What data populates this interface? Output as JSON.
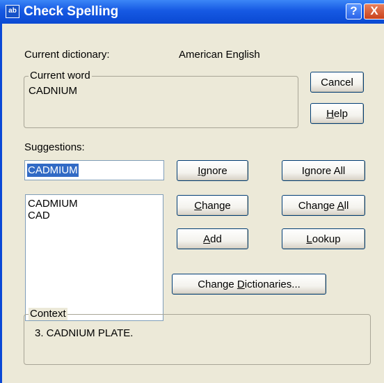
{
  "window": {
    "title": "Check Spelling",
    "icon": "spell-check-icon",
    "help_glyph": "?",
    "close_glyph": "X"
  },
  "dictionary": {
    "label": "Current dictionary:",
    "value": "American English"
  },
  "current_word": {
    "legend": "Current word",
    "value": "CADNIUM"
  },
  "suggestions": {
    "label": "Suggestions:",
    "input_value": "CADMIUM",
    "items": [
      "CADMIUM",
      "CAD"
    ]
  },
  "context": {
    "legend": "Context",
    "value": "3. CADNIUM PLATE."
  },
  "buttons": {
    "cancel": "Cancel",
    "help": {
      "mnemonic": "H",
      "rest": "elp"
    },
    "ignore": {
      "mnemonic": "I",
      "rest": "gnore"
    },
    "ignore_all": {
      "pre": "I",
      "mnemonic": "g",
      "rest": "nore All"
    },
    "change": {
      "mnemonic": "C",
      "rest": "hange"
    },
    "change_all": {
      "pre": "Change ",
      "mnemonic": "A",
      "rest": "ll"
    },
    "add": {
      "mnemonic": "A",
      "rest": "dd"
    },
    "lookup": {
      "mnemonic": "L",
      "rest": "ookup"
    },
    "change_dictionaries": {
      "pre": "Change ",
      "mnemonic": "D",
      "rest": "ictionaries..."
    }
  },
  "colors": {
    "titlebar": "#0a49d2",
    "dialog_bg": "#ece9d8",
    "selection": "#316ac5"
  }
}
